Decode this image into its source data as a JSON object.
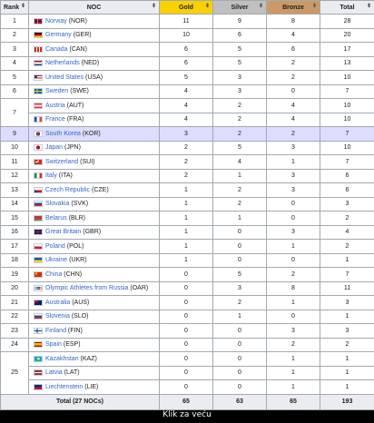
{
  "headers": {
    "rank": "Rank",
    "noc": "NOC",
    "gold": "Gold",
    "silver": "Silver",
    "bronze": "Bronze",
    "total": "Total",
    "sort_icon": "sort-arrows-icon"
  },
  "rows": [
    {
      "rank": "1",
      "country": "Norway",
      "code": "(NOR)",
      "gold": "11",
      "silver": "9",
      "bronze": "8",
      "total": "28",
      "flag": "norway-flag",
      "flag_bg": "linear-gradient(90deg,transparent 0 30%,#fff 30% 32%,#00205b 32% 40%,#fff 40% 42%,transparent 42%),linear-gradient(180deg,transparent 0 40%,#fff 40% 44%,#00205b 44% 56%,#fff 56% 60%,transparent 60%),#ba0c2f"
    },
    {
      "rank": "2",
      "country": "Germany",
      "code": "(GER)",
      "gold": "10",
      "silver": "6",
      "bronze": "4",
      "total": "20",
      "flag": "germany-flag",
      "flag_bg": "linear-gradient(180deg,#000 0 33%,#dd0000 33% 66%,#ffce00 66%)"
    },
    {
      "rank": "3",
      "country": "Canada",
      "code": "(CAN)",
      "gold": "6",
      "silver": "5",
      "bronze": "6",
      "total": "17",
      "flag": "canada-flag",
      "flag_bg": "linear-gradient(90deg,#d52b1e 0 25%,#fff 25% 40%,#d52b1e 40% 60%,#fff 60% 75%,#d52b1e 75%)"
    },
    {
      "rank": "4",
      "country": "Netherlands",
      "code": "(NED)",
      "gold": "6",
      "silver": "5",
      "bronze": "2",
      "total": "13",
      "flag": "netherlands-flag",
      "flag_bg": "linear-gradient(180deg,#ae1c28 0 33%,#fff 33% 66%,#21468b 66%)"
    },
    {
      "rank": "5",
      "country": "United States",
      "code": "(USA)",
      "gold": "5",
      "silver": "3",
      "bronze": "2",
      "total": "10",
      "flag": "usa-flag",
      "flag_bg": "linear-gradient(90deg,#3c3b6e 0 40%,transparent 40%) 0 0/100% 55% no-repeat,repeating-linear-gradient(180deg,#b22234 0 1.2px,#fff 1.2px 2.4px)"
    },
    {
      "rank": "6",
      "country": "Sweden",
      "code": "(SWE)",
      "gold": "4",
      "silver": "3",
      "bronze": "0",
      "total": "7",
      "flag": "sweden-flag",
      "flag_bg": "linear-gradient(90deg,transparent 0 30%,#fecc02 30% 42%,transparent 42%),linear-gradient(180deg,transparent 0 40%,#fecc02 40% 60%,transparent 60%),#006aa7"
    },
    {
      "rank": "7",
      "country": "Austria",
      "code": "(AUT)",
      "gold": "4",
      "silver": "2",
      "bronze": "4",
      "total": "10",
      "flag": "austria-flag",
      "flag_bg": "linear-gradient(180deg,#ed2939 0 33%,#fff 33% 66%,#ed2939 66%)"
    },
    {
      "rank": "",
      "country": "France",
      "code": "(FRA)",
      "gold": "4",
      "silver": "2",
      "bronze": "4",
      "total": "10",
      "flag": "france-flag",
      "flag_bg": "linear-gradient(90deg,#0055a4 0 33%,#fff 33% 66%,#ef4135 66%)"
    },
    {
      "rank": "9",
      "country": "South Korea",
      "code": "(KOR)",
      "gold": "3",
      "silver": "2",
      "bronze": "2",
      "total": "7",
      "flag": "south-korea-flag",
      "flag_bg": "radial-gradient(circle at 50% 50%,#cd2e3a 0 1.5px,#0047a0 1.5px 2.2px,transparent 2.2px),#fff",
      "highlight": true
    },
    {
      "rank": "10",
      "country": "Japan",
      "code": "(JPN)",
      "gold": "2",
      "silver": "5",
      "bronze": "3",
      "total": "10",
      "flag": "japan-flag",
      "flag_bg": "radial-gradient(circle at 50% 50%,#bc002d 0 2px,#fff 2.2px)"
    },
    {
      "rank": "11",
      "country": "Switzerland",
      "code": "(SUI)",
      "gold": "2",
      "silver": "4",
      "bronze": "1",
      "total": "7",
      "flag": "switzerland-flag",
      "flag_bg": "linear-gradient(90deg,transparent 0 42%,#fff 42% 58%,transparent 58%) 0 25%/100% 50% no-repeat,linear-gradient(180deg,transparent 0 42%,#fff 42% 58%,transparent 58%) 30% 0/40% 100% no-repeat,#d52b1e"
    },
    {
      "rank": "12",
      "country": "Italy",
      "code": "(ITA)",
      "gold": "2",
      "silver": "1",
      "bronze": "3",
      "total": "6",
      "flag": "italy-flag",
      "flag_bg": "linear-gradient(90deg,#009246 0 33%,#fff 33% 66%,#ce2b37 66%)"
    },
    {
      "rank": "13",
      "country": "Czech Republic",
      "code": "(CZE)",
      "gold": "1",
      "silver": "2",
      "bronze": "3",
      "total": "6",
      "flag": "czech-flag",
      "flag_bg": "linear-gradient(to top right,#11457e 0 30%,transparent 30%),linear-gradient(180deg,#fff 0 50%,#d7141a 50%)"
    },
    {
      "rank": "14",
      "country": "Slovakia",
      "code": "(SVK)",
      "gold": "1",
      "silver": "2",
      "bronze": "0",
      "total": "3",
      "flag": "slovakia-flag",
      "flag_bg": "linear-gradient(180deg,#fff 0 33%,#0b4ea2 33% 66%,#ee1c25 66%)"
    },
    {
      "rank": "15",
      "country": "Belarus",
      "code": "(BLR)",
      "gold": "1",
      "silver": "1",
      "bronze": "0",
      "total": "2",
      "flag": "belarus-flag",
      "flag_bg": "linear-gradient(90deg,#c8313e 0 15%,transparent 15%),linear-gradient(180deg,#c8313e 0 66%,#4aa657 66%)"
    },
    {
      "rank": "16",
      "country": "Great Britain",
      "code": "(GBR)",
      "gold": "1",
      "silver": "0",
      "bronze": "3",
      "total": "4",
      "flag": "great-britain-flag",
      "flag_bg": "linear-gradient(90deg,transparent 0 42%,#c8102e 42% 58%,transparent 58%),linear-gradient(180deg,transparent 0 38%,#c8102e 38% 62%,transparent 62%),#012169"
    },
    {
      "rank": "17",
      "country": "Poland",
      "code": "(POL)",
      "gold": "1",
      "silver": "0",
      "bronze": "1",
      "total": "2",
      "flag": "poland-flag",
      "flag_bg": "linear-gradient(180deg,#fff 0 50%,#dc143c 50%)"
    },
    {
      "rank": "18",
      "country": "Ukraine",
      "code": "(UKR)",
      "gold": "1",
      "silver": "0",
      "bronze": "0",
      "total": "1",
      "flag": "ukraine-flag",
      "flag_bg": "linear-gradient(180deg,#0057b7 0 50%,#ffd700 50%)"
    },
    {
      "rank": "19",
      "country": "China",
      "code": "(CHN)",
      "gold": "0",
      "silver": "5",
      "bronze": "2",
      "total": "7",
      "flag": "china-flag",
      "flag_bg": "radial-gradient(circle at 25% 30%,#ffde00 0 1px,transparent 1.2px),#de2910"
    },
    {
      "rank": "20",
      "country": "Olympic Athletes from Russia",
      "code": "(OAR)",
      "gold": "0",
      "silver": "3",
      "bronze": "8",
      "total": "11",
      "flag": "olympic-rings-icon",
      "flag_bg": "radial-gradient(circle at 25% 50%,transparent 0 0.9px,#0085c7 0.9px 1.5px,transparent 1.5px),radial-gradient(circle at 50% 50%,transparent 0 0.9px,#000 0.9px 1.5px,transparent 1.5px),radial-gradient(circle at 75% 50%,transparent 0 0.9px,#df0024 0.9px 1.5px,transparent 1.5px),#fff"
    },
    {
      "rank": "21",
      "country": "Australia",
      "code": "(AUS)",
      "gold": "0",
      "silver": "2",
      "bronze": "1",
      "total": "3",
      "flag": "australia-flag",
      "flag_bg": "linear-gradient(90deg,#c8102e 0 45%,transparent 45%) 0 0/100% 50% no-repeat,#012169"
    },
    {
      "rank": "22",
      "country": "Slovenia",
      "code": "(SLO)",
      "gold": "0",
      "silver": "1",
      "bronze": "0",
      "total": "1",
      "flag": "slovenia-flag",
      "flag_bg": "linear-gradient(180deg,#fff 0 33%,#005da4 33% 66%,#ed1c24 66%)"
    },
    {
      "rank": "23",
      "country": "Finland",
      "code": "(FIN)",
      "gold": "0",
      "silver": "0",
      "bronze": "3",
      "total": "3",
      "flag": "finland-flag",
      "flag_bg": "linear-gradient(90deg,transparent 0 30%,#003580 30% 45%,transparent 45%),linear-gradient(180deg,transparent 0 38%,#003580 38% 62%,transparent 62%),#fff"
    },
    {
      "rank": "24",
      "country": "Spain",
      "code": "(ESP)",
      "gold": "0",
      "silver": "0",
      "bronze": "2",
      "total": "2",
      "flag": "spain-flag",
      "flag_bg": "linear-gradient(180deg,#aa151b 0 25%,#f1bf00 25% 75%,#aa151b 75%)"
    },
    {
      "rank": "25",
      "country": "Kazakhstan",
      "code": "(KAZ)",
      "gold": "0",
      "silver": "0",
      "bronze": "1",
      "total": "1",
      "flag": "kazakhstan-flag",
      "flag_bg": "radial-gradient(circle at 55% 45%,#ffec2d 0 1.3px,transparent 1.5px),#00afca"
    },
    {
      "rank": "",
      "country": "Latvia",
      "code": "(LAT)",
      "gold": "0",
      "silver": "0",
      "bronze": "1",
      "total": "1",
      "flag": "latvia-flag",
      "flag_bg": "linear-gradient(180deg,#9e3039 0 40%,#fff 40% 60%,#9e3039 60%)"
    },
    {
      "rank": "",
      "country": "Liechtenstein",
      "code": "(LIE)",
      "gold": "0",
      "silver": "0",
      "bronze": "1",
      "total": "1",
      "flag": "liechtenstein-flag",
      "flag_bg": "linear-gradient(180deg,#002b7f 0 50%,#ce1126 50%)"
    }
  ],
  "footer": {
    "label": "Total (27 NOCs)",
    "gold": "65",
    "silver": "63",
    "bronze": "65",
    "total": "193"
  },
  "caption": "Klik za veću"
}
